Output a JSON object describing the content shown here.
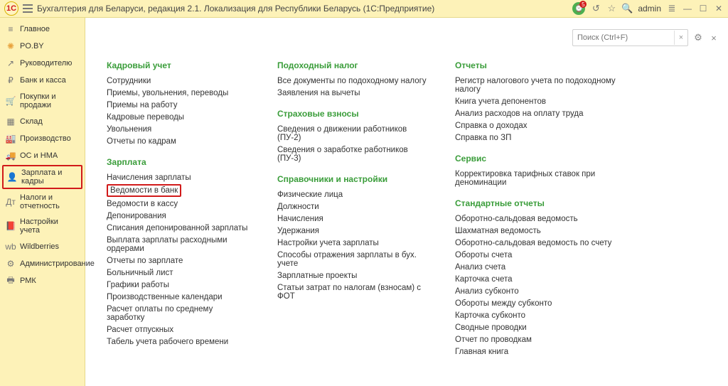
{
  "titlebar": {
    "title": "Бухгалтерия для Беларуси, редакция 2.1. Локализация для Республики Беларусь   (1С:Предприятие)",
    "user": "admin",
    "badge_count": "5"
  },
  "sidebar": {
    "items": [
      {
        "icon": "≡",
        "label": "Главное",
        "name": "nav-glavnoe"
      },
      {
        "icon": "✺",
        "label": "PO.BY",
        "name": "nav-poby",
        "icon_class": "star"
      },
      {
        "icon": "↗",
        "label": "Руководителю",
        "name": "nav-rukovoditel"
      },
      {
        "icon": "₽",
        "label": "Банк и касса",
        "name": "nav-bank-kassa"
      },
      {
        "icon": "🛒",
        "label": "Покупки и продажи",
        "name": "nav-pokupki-prodazhi"
      },
      {
        "icon": "▦",
        "label": "Склад",
        "name": "nav-sklad"
      },
      {
        "icon": "🏭",
        "label": "Производство",
        "name": "nav-proizvodstvo"
      },
      {
        "icon": "🚚",
        "label": "ОС и НМА",
        "name": "nav-os-nma"
      },
      {
        "icon": "👤",
        "label": "Зарплата и кадры",
        "name": "nav-zarplata-kadry",
        "selected": true
      },
      {
        "icon": "Дт",
        "label": "Налоги и отчетность",
        "name": "nav-nalogi"
      },
      {
        "icon": "📕",
        "label": "Настройки учета",
        "name": "nav-nastroiki-ucheta"
      },
      {
        "icon": "wb",
        "label": "Wildberries",
        "name": "nav-wildberries"
      },
      {
        "icon": "⚙",
        "label": "Администрирование",
        "name": "nav-admin"
      },
      {
        "icon": "🖶",
        "label": "РМК",
        "name": "nav-rmk"
      }
    ]
  },
  "toolbar": {
    "search_placeholder": "Поиск (Ctrl+F)"
  },
  "columns": [
    {
      "sections": [
        {
          "title": "Кадровый учет",
          "items": [
            "Сотрудники",
            "Приемы, увольнения, переводы",
            "Приемы на работу",
            "Кадровые переводы",
            "Увольнения",
            "Отчеты по кадрам"
          ]
        },
        {
          "title": "Зарплата",
          "items": [
            "Начисления зарплаты",
            {
              "label": "Ведомости в банк",
              "highlighted": true
            },
            "Ведомости в кассу",
            "Депонирования",
            "Списания депонированной зарплаты",
            "Выплата зарплаты расходными ордерами",
            "Отчеты по зарплате",
            "Больничный лист",
            "Графики работы",
            "Производственные календари",
            "Расчет оплаты по среднему заработку",
            "Расчет отпускных",
            "Табель учета рабочего времени"
          ]
        }
      ]
    },
    {
      "sections": [
        {
          "title": "Подоходный налог",
          "items": [
            "Все документы по подоходному налогу",
            "Заявления на вычеты"
          ]
        },
        {
          "title": "Страховые взносы",
          "items": [
            "Сведения о движении работников (ПУ-2)",
            "Сведения о заработке работников (ПУ-3)"
          ]
        },
        {
          "title": "Справочники и настройки",
          "items": [
            "Физические лица",
            "Должности",
            "Начисления",
            "Удержания",
            "Настройки учета зарплаты",
            "Способы отражения зарплаты в бух. учете",
            "Зарплатные проекты",
            "Статьи затрат по налогам (взносам) с ФОТ"
          ]
        }
      ]
    },
    {
      "sections": [
        {
          "title": "Отчеты",
          "items": [
            "Регистр налогового учета по подоходному налогу",
            "Книга учета депонентов",
            "Анализ расходов на оплату труда",
            "Справка о доходах",
            "Справка по ЗП"
          ]
        },
        {
          "title": "Сервис",
          "items": [
            "Корректировка тарифных ставок при деноминации"
          ]
        },
        {
          "title": "Стандартные отчеты",
          "items": [
            "Оборотно-сальдовая ведомость",
            "Шахматная ведомость",
            "Оборотно-сальдовая ведомость по счету",
            "Обороты счета",
            "Анализ счета",
            "Карточка счета",
            "Анализ субконто",
            "Обороты между субконто",
            "Карточка субконто",
            "Сводные проводки",
            "Отчет по проводкам",
            "Главная книга"
          ]
        }
      ]
    }
  ]
}
